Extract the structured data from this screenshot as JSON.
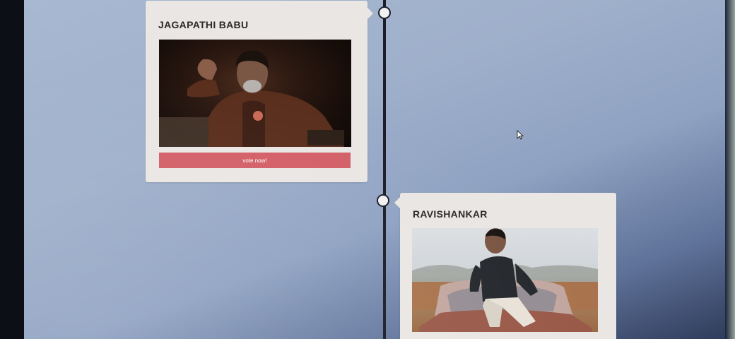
{
  "timeline": {
    "cards": [
      {
        "title": "JAGAPATHI BABU",
        "photo_alt": "Portrait in dark brown jacket",
        "button_label": "vote now!"
      },
      {
        "title": "RAVISHANKAR",
        "photo_alt": "Man seated on car hood outdoors"
      }
    ]
  },
  "colors": {
    "card_bg": "#e9e6e3",
    "vote_button": "#d35f68",
    "timeline_line": "#1b1e27",
    "page_bg": "#9fb0cb"
  },
  "icons": {
    "cursor": "mouse-pointer-icon"
  }
}
